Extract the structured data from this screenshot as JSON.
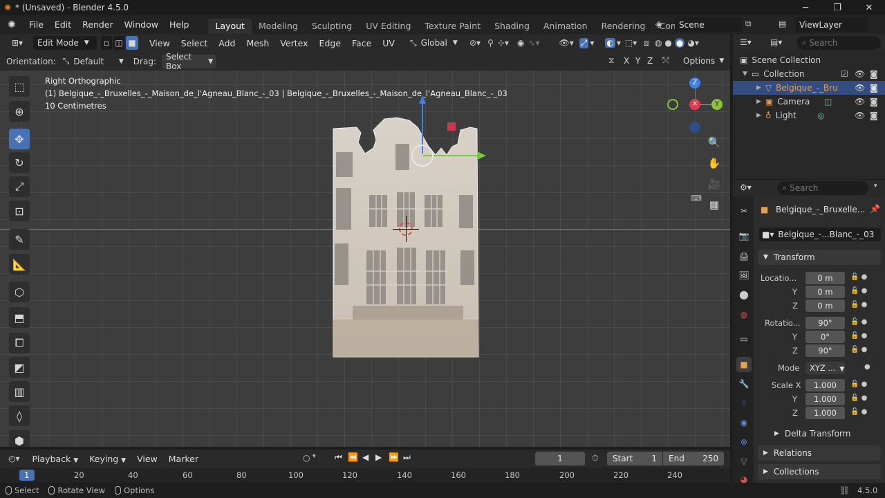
{
  "window": {
    "title": "* (Unsaved) - Blender 4.5.0",
    "minimize": "─",
    "maximize": "❐",
    "close": "✕"
  },
  "menu": [
    "File",
    "Edit",
    "Render",
    "Window",
    "Help"
  ],
  "workspaces": [
    "Layout",
    "Modeling",
    "Sculpting",
    "UV Editing",
    "Texture Paint",
    "Shading",
    "Animation",
    "Rendering",
    "Compositing"
  ],
  "active_workspace": "Layout",
  "scene": {
    "name": "Scene",
    "view_layer": "ViewLayer"
  },
  "viewport_header": {
    "mode": "Edit Mode",
    "menus": [
      "View",
      "Select",
      "Add",
      "Mesh",
      "Vertex",
      "Edge",
      "Face",
      "UV"
    ],
    "transform_orientation": "Global"
  },
  "tool_settings": {
    "orientation_label": "Orientation:",
    "orientation_value": "Default",
    "drag_label": "Drag:",
    "drag_value": "Select Box",
    "axis_x": "X",
    "axis_y": "Y",
    "axis_z": "Z",
    "options": "Options"
  },
  "viewport": {
    "view_name": "Right Orthographic",
    "object_info": "(1) Belgique_-_Bruxelles_-_Maison_de_l'Agneau_Blanc_-_03 | Belgique_-_Bruxelles_-_Maison_de_l'Agneau_Blanc_-_03",
    "scale": "10 Centimetres",
    "gizmo": {
      "z": "Z",
      "y": "Y"
    }
  },
  "outliner": {
    "search_placeholder": "Search",
    "scene_collection": "Scene Collection",
    "collection": "Collection",
    "items": [
      "Belgique_-_Bru",
      "Camera",
      "Light"
    ]
  },
  "properties": {
    "search_placeholder": "Search",
    "object_name": "Belgique_-_Bruxelle...",
    "data_name": "Belgique_-...Blanc_-_03",
    "transform_title": "Transform",
    "location_label": "Locatio...",
    "location": [
      "0 m",
      "0 m",
      "0 m"
    ],
    "rotation_label": "Rotatio...",
    "rotation": [
      "90°",
      "0°",
      "90°"
    ],
    "mode_label": "Mode",
    "mode_value": "XYZ ...",
    "scale_label": "Scale X",
    "scale": [
      "1.000",
      "1.000",
      "1.000"
    ],
    "axis_y": "Y",
    "axis_z": "Z",
    "delta_transform": "Delta Transform",
    "relations": "Relations",
    "collections": "Collections"
  },
  "timeline": {
    "menus": [
      "Playback",
      "Keying",
      "View",
      "Marker"
    ],
    "current_frame": "1",
    "start_label": "Start",
    "start": "1",
    "end_label": "End",
    "end": "250",
    "ruler": [
      "1",
      "20",
      "40",
      "60",
      "80",
      "100",
      "120",
      "140",
      "160",
      "180",
      "200",
      "220",
      "240"
    ]
  },
  "statusbar": {
    "select": "Select",
    "rotate": "Rotate View",
    "options": "Options",
    "version": "4.5.0"
  }
}
